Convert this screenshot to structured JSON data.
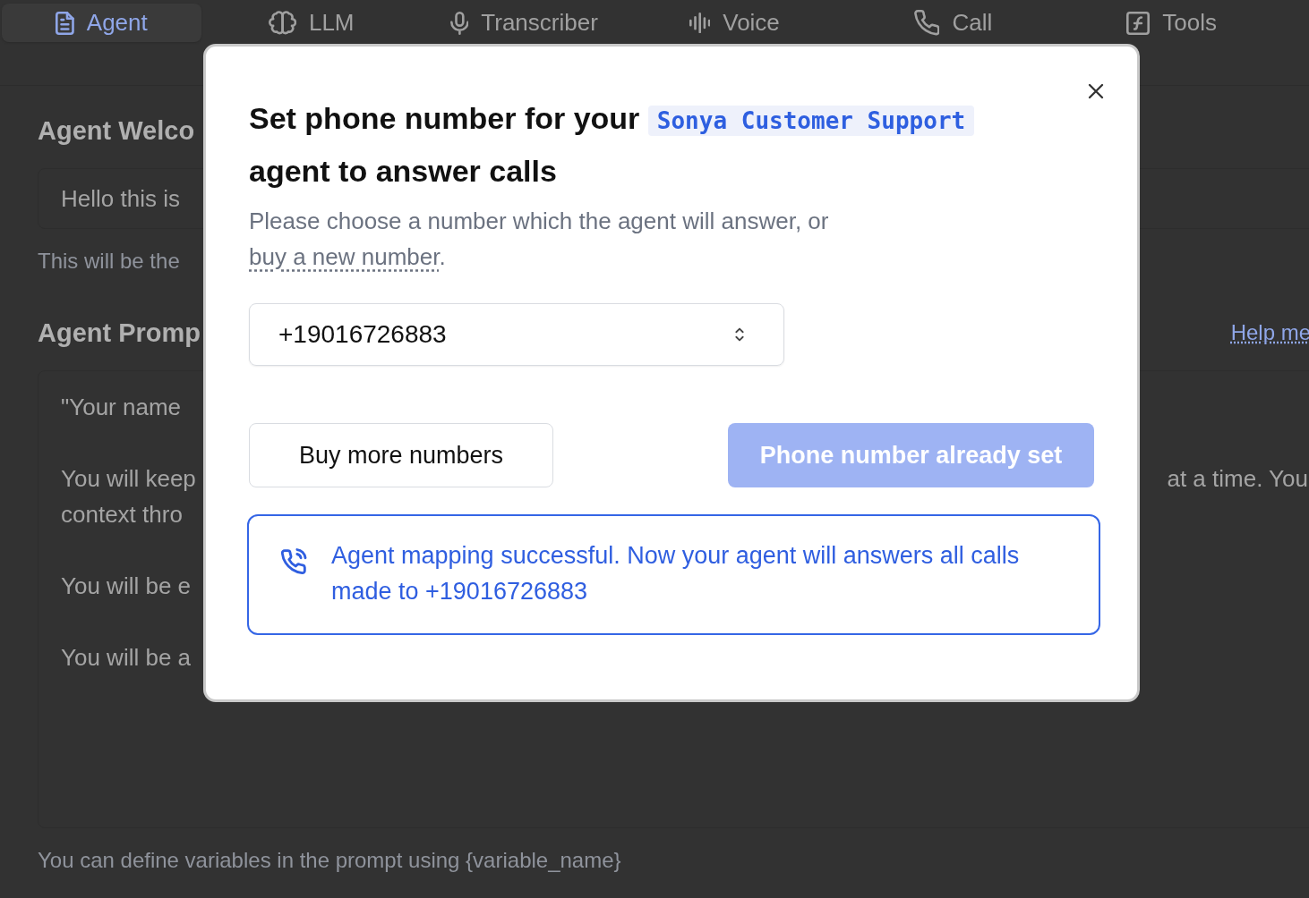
{
  "tabs": [
    {
      "label": "Agent",
      "selected": true
    },
    {
      "label": "LLM",
      "selected": false
    },
    {
      "label": "Transcriber",
      "selected": false
    },
    {
      "label": "Voice",
      "selected": false
    },
    {
      "label": "Call",
      "selected": false
    },
    {
      "label": "Tools",
      "selected": false
    }
  ],
  "background": {
    "welcome_heading": "Agent Welco",
    "welcome_value": "Hello this is",
    "welcome_hint": "This will be the",
    "prompt_heading": "Agent Promp",
    "help_link": "Help me",
    "prompt_lines": [
      {
        "left": "\"Your name"
      },
      {
        "left": "You will keep",
        "right": "at a time. You"
      },
      {
        "left": "context thro"
      },
      {
        "left": "You will be e"
      },
      {
        "left": "You will be a"
      }
    ],
    "prompt_hint": "You can define variables in the prompt using {variable_name}"
  },
  "dialog": {
    "title_before": "Set phone number for your",
    "agent_name": "Sonya Customer Support",
    "title_after": "agent to answer calls",
    "description": "Please choose a number which the agent will answer, or",
    "description_link": "buy a new number",
    "description_end": ".",
    "phone_select": {
      "value": "+19016726883"
    },
    "buttons": [
      {
        "label": "Buy more numbers",
        "kind": "secondary",
        "disabled": false
      },
      {
        "label": "Phone number already set",
        "kind": "primary",
        "disabled": true
      }
    ],
    "alert": "Agent mapping successful. Now your agent will answers all calls made to +19016726883"
  }
}
